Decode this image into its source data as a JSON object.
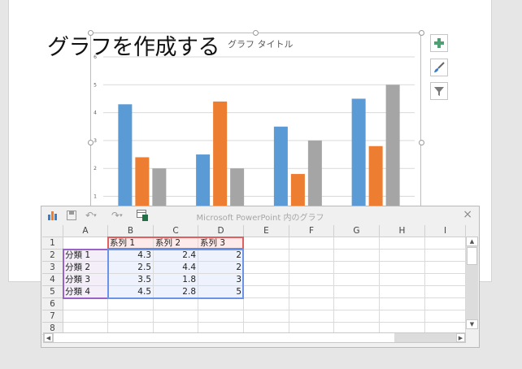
{
  "slide": {
    "title": "グラフを作成する"
  },
  "chart_data": {
    "type": "bar",
    "title": "グラフ タイトル",
    "categories": [
      "分類 1",
      "分類 2",
      "分類 3",
      "分類 4"
    ],
    "series": [
      {
        "name": "系列 1",
        "values": [
          4.3,
          2.5,
          3.5,
          4.5
        ],
        "color": "#5b9bd5"
      },
      {
        "name": "系列 2",
        "values": [
          2.4,
          4.4,
          1.8,
          2.8
        ],
        "color": "#ed7d31"
      },
      {
        "name": "系列 3",
        "values": [
          2,
          2,
          3,
          5
        ],
        "color": "#a5a5a5"
      }
    ],
    "ylim": [
      0,
      6
    ],
    "yticks": [
      "0",
      "1",
      "2",
      "3",
      "4",
      "5",
      "6"
    ],
    "grid": true
  },
  "side_buttons": [
    {
      "icon": "plus-icon",
      "color": "#4ea072"
    },
    {
      "icon": "brush-icon",
      "color": "#3d7dc8"
    },
    {
      "icon": "filter-icon",
      "color": "#7a7a7a"
    }
  ],
  "dialog": {
    "title": "Microsoft PowerPoint 内のグラフ",
    "close": "×",
    "columns": [
      "A",
      "B",
      "C",
      "D",
      "E",
      "F",
      "G",
      "H",
      "I"
    ],
    "rows": [
      "1",
      "2",
      "3",
      "4",
      "5",
      "6",
      "7",
      "8"
    ],
    "cells": [
      [
        "",
        "系列 1",
        "系列 2",
        "系列 3"
      ],
      [
        "分類 1",
        "4.3",
        "2.4",
        "2"
      ],
      [
        "分類 2",
        "2.5",
        "4.4",
        "2"
      ],
      [
        "分類 3",
        "3.5",
        "1.8",
        "3"
      ],
      [
        "分類 4",
        "4.5",
        "2.8",
        "5"
      ]
    ]
  }
}
